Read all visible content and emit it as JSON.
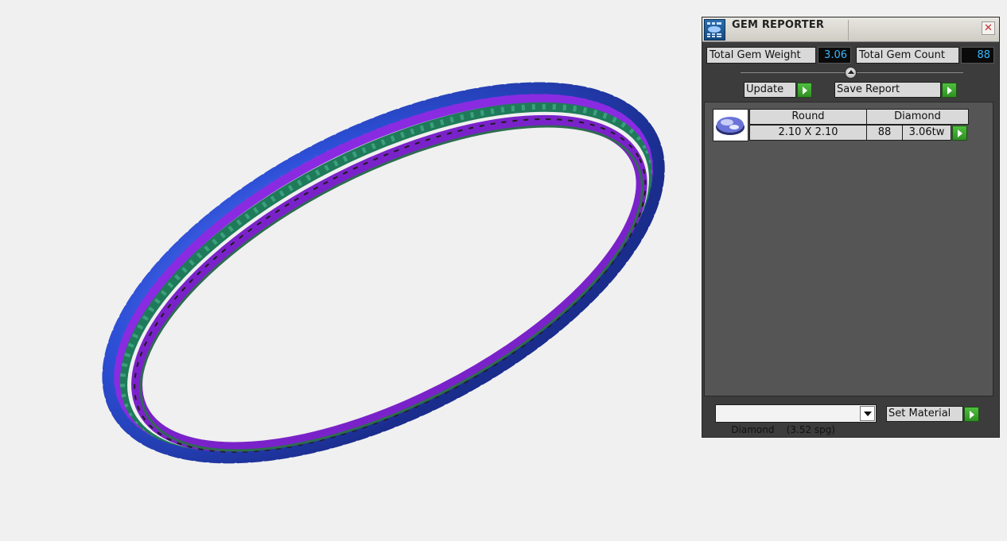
{
  "panel": {
    "title": "GEM REPORTER",
    "close_glyph": "✕",
    "total_weight_label": "Total Gem Weight",
    "total_weight_value": "3.06",
    "total_count_label": "Total Gem Count",
    "total_count_value": "88",
    "update_label": "Update",
    "save_report_label": "Save Report",
    "gem": {
      "shape": "Round",
      "material": "Diamond",
      "size": "2.10 X 2.10",
      "count": "88",
      "weight": "3.06tw"
    },
    "material_select": {
      "value": "Diamond    (3.52 spg)"
    },
    "set_material_label": "Set Material"
  },
  "colors": {
    "accent_value": "#37b8ff",
    "play_green": "#3fa52f",
    "gem_blue": "#2d4fd6",
    "metal_purple": "#8a2be2",
    "setting_green": "#1f7a5a"
  },
  "icons": [
    "gem-reporter-app-icon",
    "close-icon",
    "play-icon",
    "round-gem-icon",
    "dropdown-arrow-icon",
    "slider-thumb-icon"
  ]
}
